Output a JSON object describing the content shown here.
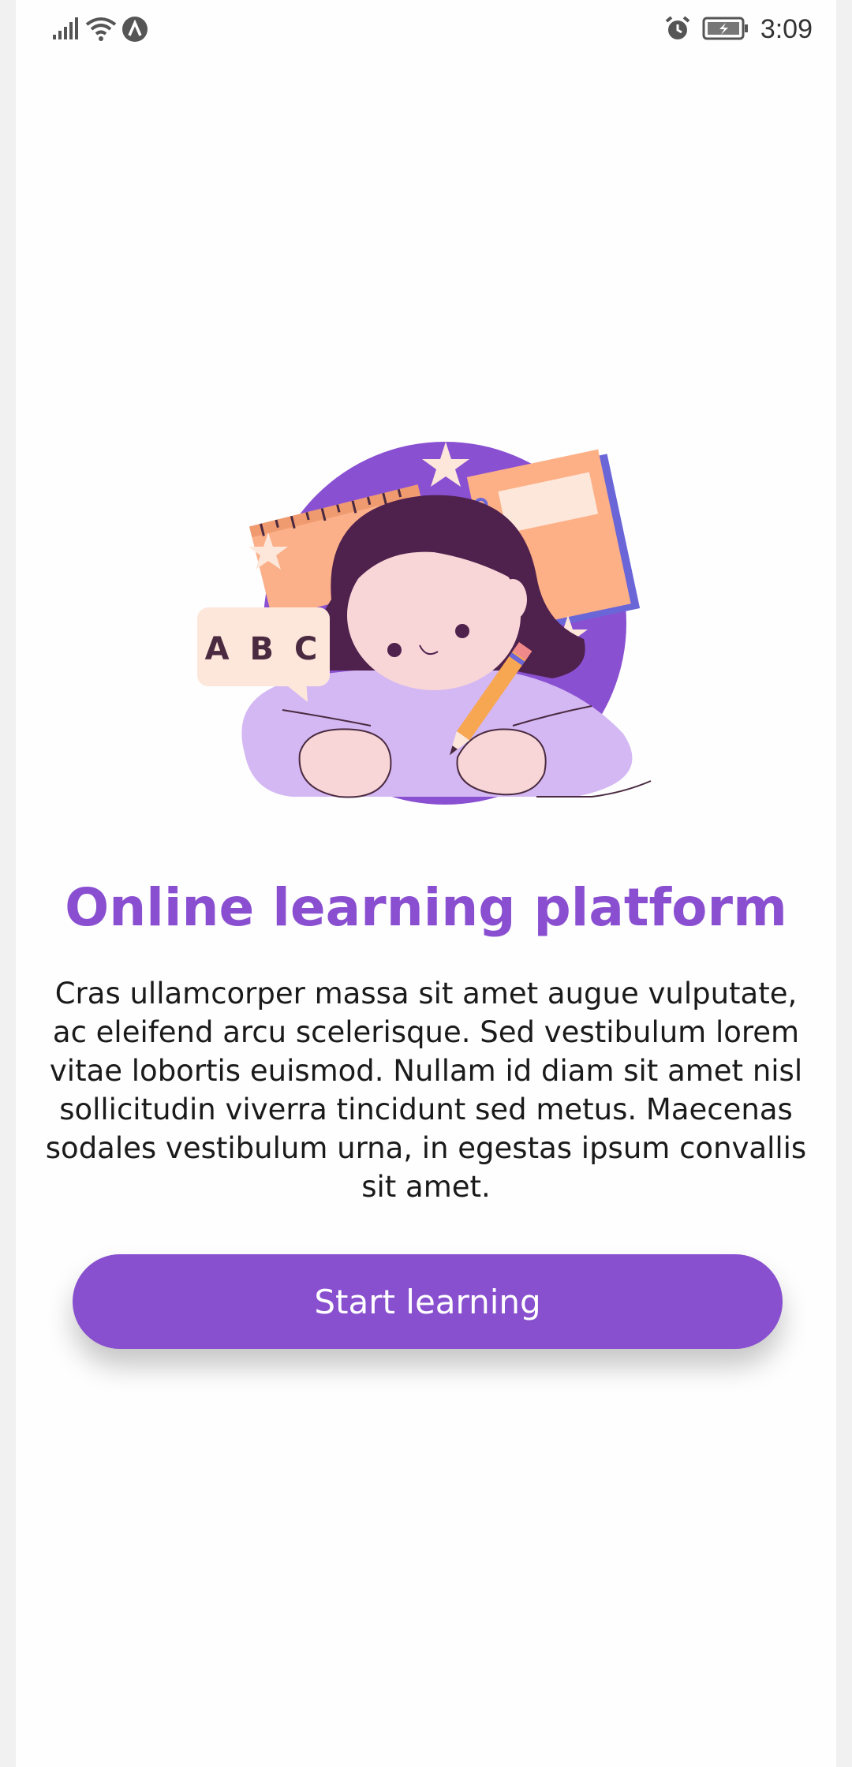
{
  "status_bar": {
    "time": "3:09",
    "left_icons": [
      "signal-icon",
      "wifi-icon",
      "app-notification-icon"
    ],
    "right_icons": [
      "alarm-icon",
      "battery-charging-icon"
    ]
  },
  "illustration": {
    "name": "girl-studying-illustration",
    "speech_bubble_text": "A B C"
  },
  "main": {
    "title": "Online learning platform",
    "description": "Cras ullamcorper massa sit amet augue vulputate, ac eleifend arcu scelerisque. Sed vestibulum lorem vitae lobortis euismod. Nullam id diam sit amet nisl sollicitudin viverra tincidunt sed metus. Maecenas sodales vestibulum urna, in egestas ipsum convallis sit amet.",
    "cta_label": "Start learning"
  },
  "colors": {
    "accent": "#884fcf",
    "title": "#8a4fd0",
    "page_background": "#fefefe"
  }
}
